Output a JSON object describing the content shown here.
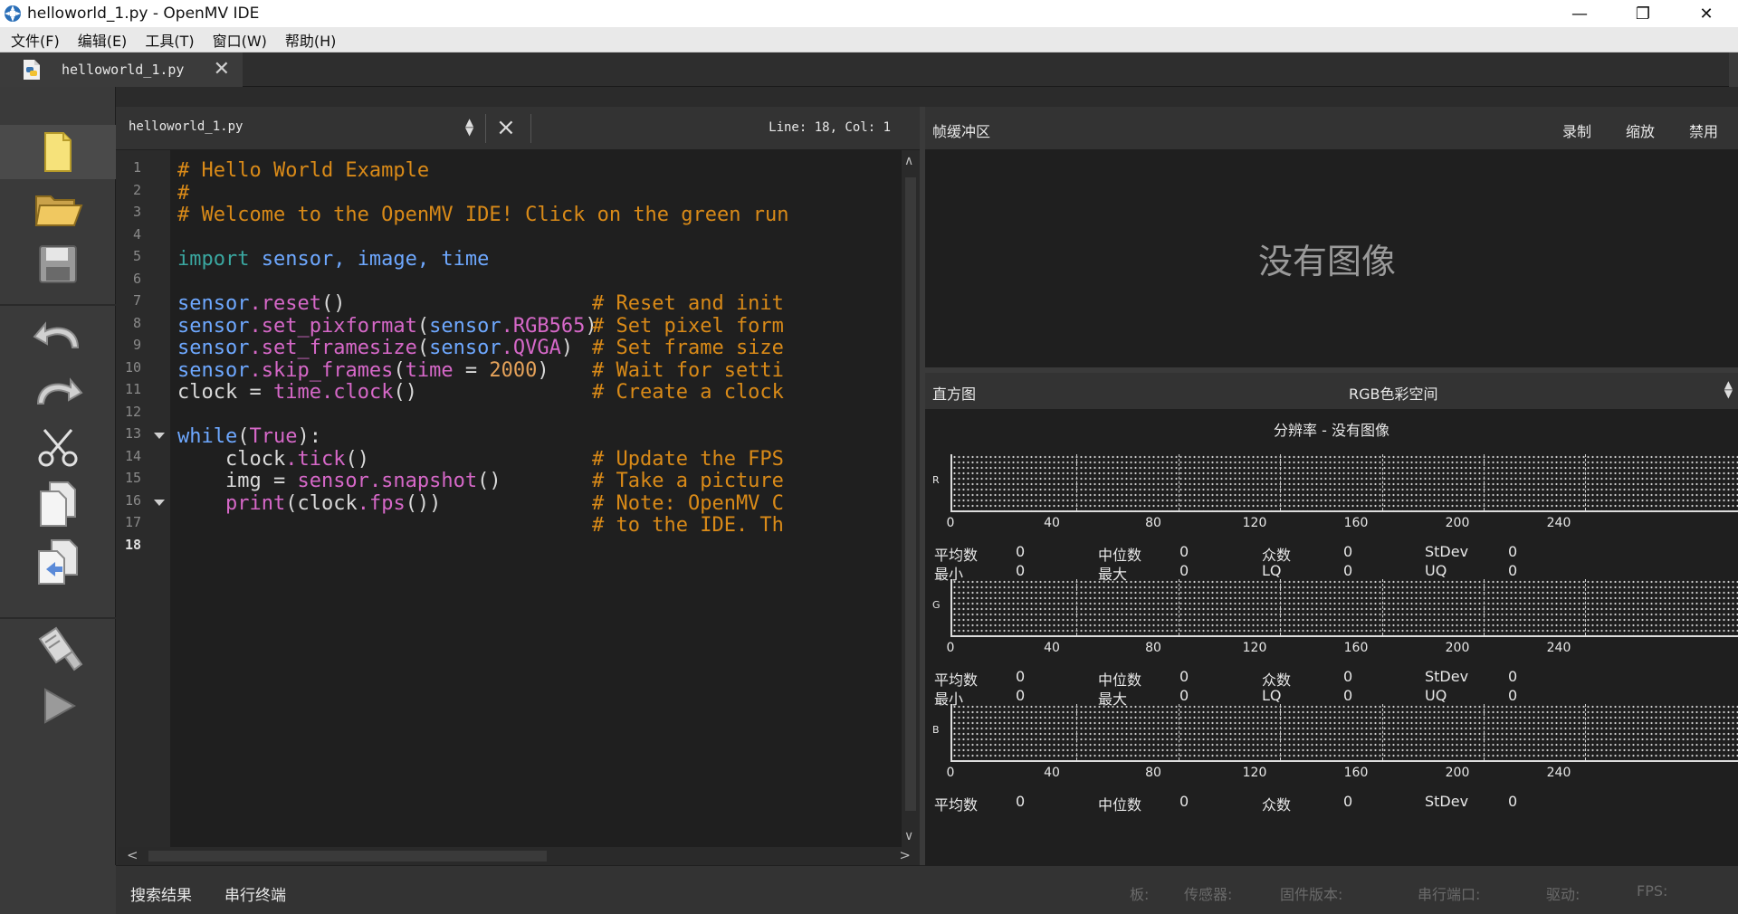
{
  "window": {
    "title": "helloworld_1.py - OpenMV IDE",
    "minimize": "—",
    "restore": "❐",
    "close": "✕"
  },
  "menu": [
    "文件(F)",
    "编辑(E)",
    "工具(T)",
    "窗口(W)",
    "帮助(H)"
  ],
  "tab": {
    "name": "helloworld_1.py",
    "close": "✕"
  },
  "editor": {
    "file_combo": "helloworld_1.py",
    "position": "Line: 18, Col: 1",
    "line_numbers": [
      "1",
      "2",
      "3",
      "4",
      "5",
      "6",
      "7",
      "8",
      "9",
      "10",
      "11",
      "12",
      "13",
      "14",
      "15",
      "16",
      "17",
      "18"
    ],
    "current_line": "18"
  },
  "code": {
    "l1": "# Hello World Example",
    "l2": "#",
    "l3": "# Welcome to the OpenMV IDE! Click on the green run",
    "l5_kw": "import",
    "l5_rest": " sensor, image, time",
    "l7_a": "sensor",
    "l7_b": ".reset",
    "l7_c": "()",
    "l7_com": "# Reset and init",
    "l8_a": "sensor",
    "l8_b": ".set_pixformat",
    "l8_c": "(",
    "l8_d": "sensor",
    "l8_e": ".RGB565",
    "l8_f": ")",
    "l8_com": "# Set pixel form",
    "l9_a": "sensor",
    "l9_b": ".set_framesize",
    "l9_c": "(",
    "l9_d": "sensor",
    "l9_e": ".QVGA",
    "l9_f": ")",
    "l9_com": "# Set frame size",
    "l10_a": "sensor",
    "l10_b": ".skip_frames",
    "l10_c": "(",
    "l10_d": "time",
    "l10_e": " = ",
    "l10_f": "2000",
    "l10_g": ")",
    "l10_com": "# Wait for setti",
    "l11_a": "clock",
    "l11_b": " = ",
    "l11_c": "time",
    "l11_d": ".clock",
    "l11_e": "()",
    "l11_com": "# Create a clock",
    "l13_a": "while",
    "l13_b": "(",
    "l13_c": "True",
    "l13_d": "):",
    "l14_a": "    clock",
    "l14_b": ".tick",
    "l14_c": "()",
    "l14_com": "# Update the FPS",
    "l15_a": "    img = ",
    "l15_b": "sensor",
    "l15_c": ".snapshot",
    "l15_d": "()",
    "l15_com": "# Take a picture",
    "l16_a": "    ",
    "l16_b": "print",
    "l16_c": "(clock",
    "l16_d": ".fps",
    "l16_e": "())",
    "l16_com": "# Note: OpenMV C",
    "l17_com": "# to the IDE. Th"
  },
  "framebuffer": {
    "title": "帧缓冲区",
    "record": "录制",
    "zoom": "缩放",
    "disable": "禁用",
    "no_image": "没有图像"
  },
  "histogram": {
    "title": "直方图",
    "color_space": "RGB色彩空间",
    "resolution": "分辨率 - 没有图像",
    "channels": [
      "R",
      "G",
      "B"
    ],
    "ticks": [
      "0",
      "40",
      "80",
      "120",
      "160",
      "200",
      "240"
    ],
    "stats_labels": {
      "mean": "平均数",
      "median": "中位数",
      "mode": "众数",
      "stdev": "StDev",
      "min": "最小",
      "max": "最大",
      "lq": "LQ",
      "uq": "UQ"
    },
    "stats_value": "0"
  },
  "bottom": {
    "search_results": "搜索结果",
    "serial_terminal": "串行终端",
    "board": "板:",
    "sensor": "传感器:",
    "firmware": "固件版本:",
    "serial_port": "串行端口:",
    "driver": "驱动:",
    "fps": "FPS:"
  },
  "colors": {
    "comment": "#d98a18",
    "keyword": "#3aa7a0",
    "function": "#d668c8",
    "background": "#1f1f1f"
  }
}
